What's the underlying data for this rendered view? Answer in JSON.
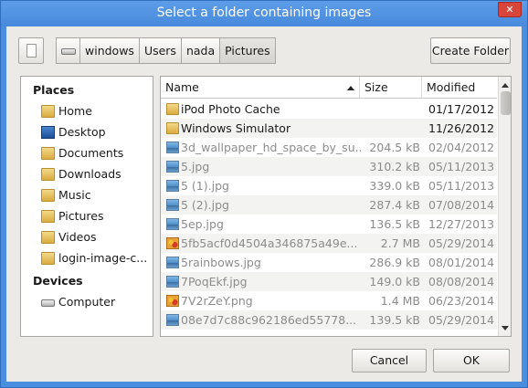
{
  "window": {
    "title": "Select a folder containing images"
  },
  "toolbar": {
    "path": [
      "windows",
      "Users",
      "nada",
      "Pictures"
    ],
    "create_folder_label": "Create Folder"
  },
  "places": {
    "heading": "Places",
    "items": [
      {
        "label": "Home",
        "icon": "home-folder-icon"
      },
      {
        "label": "Desktop",
        "icon": "desktop-icon"
      },
      {
        "label": "Documents",
        "icon": "folder-icon"
      },
      {
        "label": "Downloads",
        "icon": "folder-icon"
      },
      {
        "label": "Music",
        "icon": "folder-icon"
      },
      {
        "label": "Pictures",
        "icon": "folder-icon"
      },
      {
        "label": "Videos",
        "icon": "folder-icon"
      },
      {
        "label": "login-image-c...",
        "icon": "folder-icon"
      }
    ],
    "devices_heading": "Devices",
    "devices": [
      {
        "label": "Computer",
        "icon": "drive-icon"
      }
    ]
  },
  "files": {
    "columns": {
      "name": "Name",
      "size": "Size",
      "modified": "Modified"
    },
    "rows": [
      {
        "name": "iPod Photo Cache",
        "size": "",
        "modified": "01/17/2012",
        "kind": "folder"
      },
      {
        "name": "Windows Simulator",
        "size": "",
        "modified": "11/26/2012",
        "kind": "folder"
      },
      {
        "name": "3d_wallpaper_hd_space_by_su...",
        "size": "204.5 kB",
        "modified": "02/04/2012",
        "kind": "image"
      },
      {
        "name": "5.jpg",
        "size": "310.2 kB",
        "modified": "05/11/2013",
        "kind": "image"
      },
      {
        "name": "5 (1).jpg",
        "size": "339.0 kB",
        "modified": "05/11/2013",
        "kind": "image"
      },
      {
        "name": "5 (2).jpg",
        "size": "287.4 kB",
        "modified": "07/08/2014",
        "kind": "image"
      },
      {
        "name": "5ep.jpg",
        "size": "136.5 kB",
        "modified": "12/27/2013",
        "kind": "image"
      },
      {
        "name": "5fb5acf0d4504a346875a49e...",
        "size": "2.7 MB",
        "modified": "05/29/2014",
        "kind": "picture"
      },
      {
        "name": "5rainbows.jpg",
        "size": "286.9 kB",
        "modified": "08/01/2014",
        "kind": "image"
      },
      {
        "name": "7PoqEkf.jpg",
        "size": "149.0 kB",
        "modified": "08/08/2014",
        "kind": "image"
      },
      {
        "name": "7V2rZeY.png",
        "size": "1.4 MB",
        "modified": "06/23/2014",
        "kind": "picture"
      },
      {
        "name": "08e7d7c88c962186ed55778...",
        "size": "139.5 kB",
        "modified": "05/29/2014",
        "kind": "image"
      }
    ]
  },
  "footer": {
    "cancel_label": "Cancel",
    "ok_label": "OK"
  }
}
